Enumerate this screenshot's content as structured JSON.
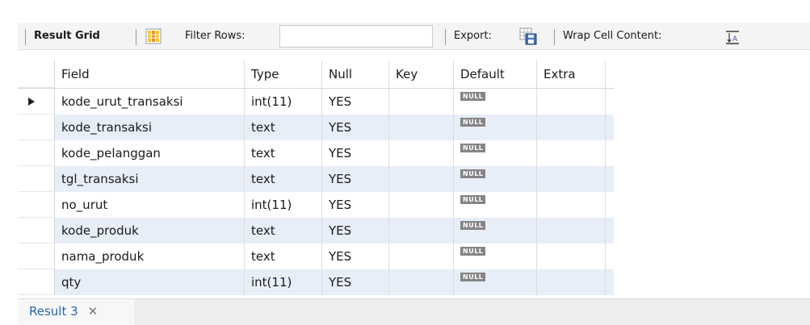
{
  "toolbar": {
    "result_grid_label": "Result Grid",
    "filter_rows_label": "Filter Rows:",
    "filter_rows_value": "",
    "export_label": "Export:",
    "wrap_cell_label": "Wrap Cell Content:",
    "icons": [
      "grid-layout-icon",
      "export-icon",
      "wrap-content-icon"
    ]
  },
  "table": {
    "columns": [
      "Field",
      "Type",
      "Null",
      "Key",
      "Default",
      "Extra"
    ],
    "null_label": "NULL",
    "rows": [
      {
        "field": "kode_urut_transaksi",
        "type": "int(11)",
        "null": "YES",
        "key": "",
        "default": "NULL",
        "extra": "",
        "current": true
      },
      {
        "field": "kode_transaksi",
        "type": "text",
        "null": "YES",
        "key": "",
        "default": "NULL",
        "extra": ""
      },
      {
        "field": "kode_pelanggan",
        "type": "text",
        "null": "YES",
        "key": "",
        "default": "NULL",
        "extra": ""
      },
      {
        "field": "tgl_transaksi",
        "type": "text",
        "null": "YES",
        "key": "",
        "default": "NULL",
        "extra": ""
      },
      {
        "field": "no_urut",
        "type": "int(11)",
        "null": "YES",
        "key": "",
        "default": "NULL",
        "extra": ""
      },
      {
        "field": "kode_produk",
        "type": "text",
        "null": "YES",
        "key": "",
        "default": "NULL",
        "extra": ""
      },
      {
        "field": "nama_produk",
        "type": "text",
        "null": "YES",
        "key": "",
        "default": "NULL",
        "extra": ""
      },
      {
        "field": "qty",
        "type": "int(11)",
        "null": "YES",
        "key": "",
        "default": "NULL",
        "extra": ""
      }
    ]
  },
  "tabs": {
    "result_tab_label": "Result 3",
    "close_glyph": "✕"
  },
  "colors": {
    "alt_row": "#e8eef8",
    "null_badge": "#858585",
    "tab_text": "#2866a8"
  }
}
